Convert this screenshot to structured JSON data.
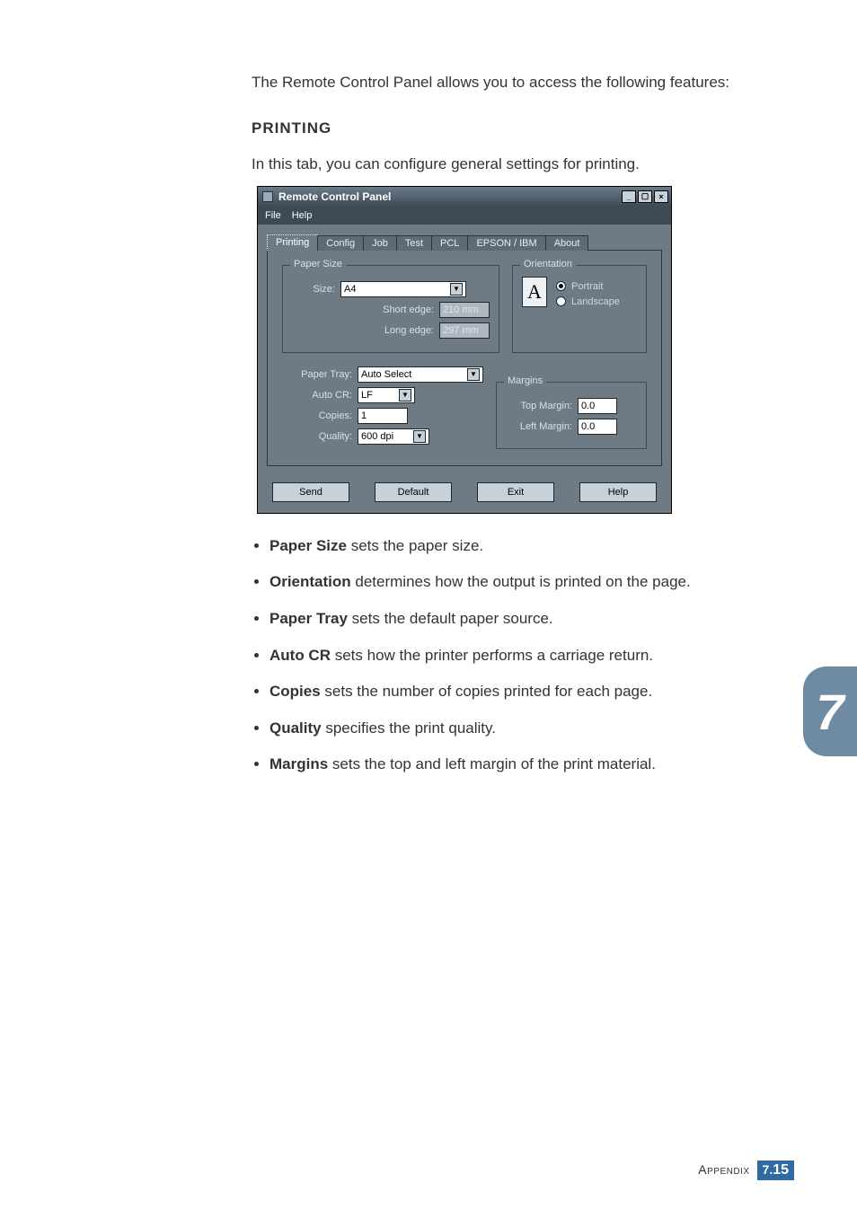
{
  "intro": "The Remote Control Panel allows you to access the following features:",
  "section_heading": "PRINTING",
  "section_intro": "In this tab, you can configure general settings for printing.",
  "window": {
    "title": "Remote Control Panel",
    "controls": {
      "min": "_",
      "max": "▢",
      "close": "×"
    },
    "menus": [
      "File",
      "Help"
    ],
    "tabs": [
      "Printing",
      "Config",
      "Job",
      "Test",
      "PCL",
      "EPSON / IBM",
      "About"
    ],
    "active_tab_index": 0,
    "paper_size": {
      "legend": "Paper Size",
      "size_label": "Size:",
      "size_value": "A4",
      "short_edge_label": "Short edge:",
      "short_edge_value": "210 mm",
      "long_edge_label": "Long edge:",
      "long_edge_value": "297 mm"
    },
    "orientation": {
      "legend": "Orientation",
      "icon_letter": "A",
      "portrait_label": "Portrait",
      "landscape_label": "Landscape",
      "portrait_selected": true
    },
    "paper_tray_label": "Paper Tray:",
    "paper_tray_value": "Auto Select",
    "auto_cr_label": "Auto CR:",
    "auto_cr_value": "LF",
    "copies_label": "Copies:",
    "copies_value": "1",
    "quality_label": "Quality:",
    "quality_value": "600 dpi",
    "margins": {
      "legend": "Margins",
      "top_label": "Top Margin:",
      "top_value": "0.0",
      "left_label": "Left Margin:",
      "left_value": "0.0"
    },
    "buttons": {
      "send": "Send",
      "default": "Default",
      "exit": "Exit",
      "help": "Help"
    }
  },
  "bullets": [
    {
      "term": "Paper Size",
      "rest": " sets the paper size."
    },
    {
      "term": "Orientation",
      "rest": " determines how the output is printed on the page."
    },
    {
      "term": "Paper Tray",
      "rest": " sets the default paper source."
    },
    {
      "term": "Auto CR",
      "rest": " sets how the printer performs a carriage return."
    },
    {
      "term": "Copies",
      "rest": " sets the number of copies printed for each page."
    },
    {
      "term": "Quality",
      "rest": " specifies the print quality."
    },
    {
      "term": "Margins",
      "rest": " sets the top and left margin of the print material."
    }
  ],
  "thumb_tab": "7",
  "footer": {
    "label": "Appendix",
    "chapter": "7",
    "dot": ".",
    "page": "15"
  }
}
